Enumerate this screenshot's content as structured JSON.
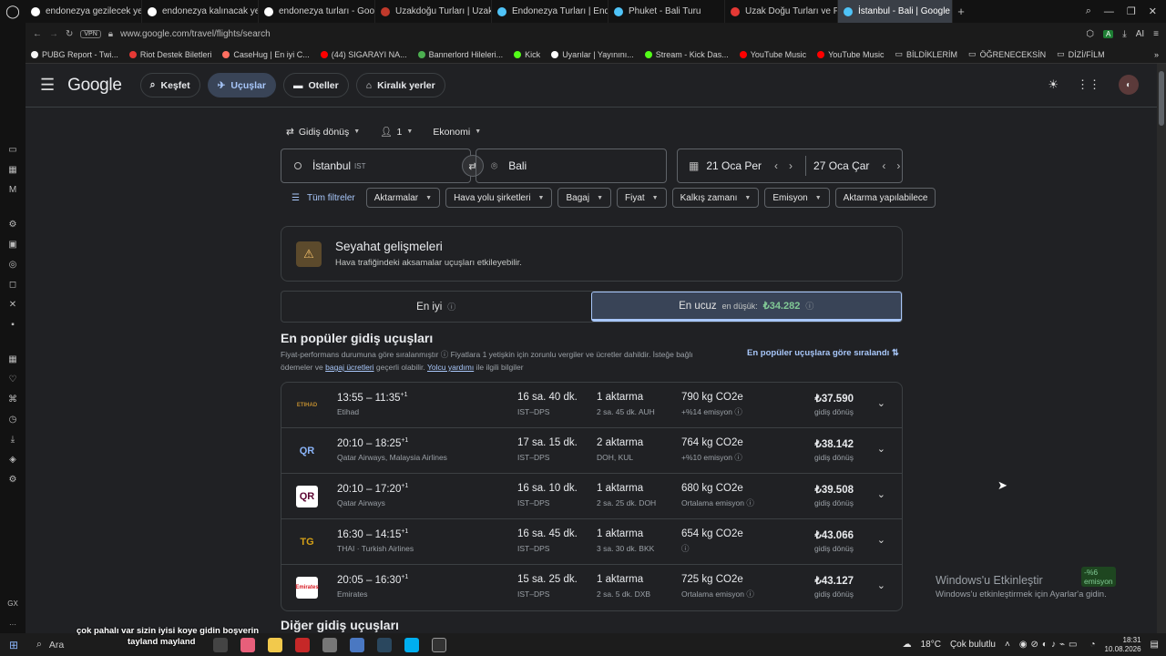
{
  "tabs": [
    {
      "title": "endonezya gezilecek yerle",
      "color": "#ffffff"
    },
    {
      "title": "endonezya kalınacak yerle",
      "color": "#ffffff"
    },
    {
      "title": "endonezya turları - Googl",
      "color": "#ffffff"
    },
    {
      "title": "Uzakdoğu Turları | Uzakdo",
      "color": "#c0392b"
    },
    {
      "title": "Endonezya Turları | Endon",
      "color": "#4fc3f7"
    },
    {
      "title": "Phuket - Bali Turu",
      "color": "#4fc3f7"
    },
    {
      "title": "Uzak Doğu Turları ve Fiyat",
      "color": "#e53935"
    },
    {
      "title": "İstanbul - Bali | Google Uçu",
      "color": "#4fc3f7"
    }
  ],
  "address": {
    "vpn": "VPN",
    "url": "www.google.com/travel/flights/search",
    "ai": "AI"
  },
  "bookmarks": [
    {
      "label": "PUBG Report - Twi...",
      "color": "#f5f5f5"
    },
    {
      "label": "Riot Destek Biletleri",
      "color": "#e53935"
    },
    {
      "label": "CaseHug | En iyi C...",
      "color": "#ff6f61"
    },
    {
      "label": "(44) SIGARAYI NA...",
      "color": "#ff0000"
    },
    {
      "label": "Bannerlord Hileleri...",
      "color": "#4caf50"
    },
    {
      "label": "Kick",
      "color": "#53fc18"
    },
    {
      "label": "Uyarılar | Yayınını...",
      "color": "#ffffff"
    },
    {
      "label": "Stream - Kick Das...",
      "color": "#53fc18"
    },
    {
      "label": "YouTube Music",
      "color": "#ff0000"
    },
    {
      "label": "YouTube Music",
      "color": "#ff0000"
    },
    {
      "label": "BİLDİKLERİM",
      "color": "#cccccc"
    },
    {
      "label": "ÖĞRENECEKSİN",
      "color": "#cccccc"
    },
    {
      "label": "DİZİ/FİLM",
      "color": "#cccccc"
    }
  ],
  "header": {
    "logo": "Google",
    "nav": [
      "Keşfet",
      "Uçuşlar",
      "Oteller",
      "Kiralık yerler"
    ]
  },
  "search": {
    "trip_type": "Gidiş dönüş",
    "passengers": "1",
    "cabin": "Ekonomi",
    "origin": "İstanbul",
    "origin_code": "IST",
    "destination": "Bali",
    "depart": "21 Oca Per",
    "return": "27 Oca Çar"
  },
  "filters": [
    "Tüm filtreler",
    "Aktarmalar",
    "Hava yolu şirketleri",
    "Bagaj",
    "Fiyat",
    "Kalkış zamanı",
    "Emisyon",
    "Aktarma yapılabilece"
  ],
  "notice": {
    "title": "Seyahat gelişmeleri",
    "text": "Hava trafiğindeki aksamalar uçuşları etkileyebilir."
  },
  "sort_tabs": {
    "best": "En iyi",
    "cheapest": "En ucuz",
    "lowest_label": "en düşük:",
    "lowest_price": "₺34.282"
  },
  "section": {
    "title": "En popüler gidiş uçuşları",
    "sub1": "Fiyat-performans durumuna göre sıralanmıştır",
    "sub2": "Fiyatlara 1 yetişkin için zorunlu vergiler ve ücretler dahildir. İsteğe bağlı ödemeler ve",
    "sub_link1": "bagaj ücretleri",
    "sub3": "geçerli olabilir.",
    "sub_link2": "Yolcu yardımı",
    "sub4": "ile ilgili bilgiler",
    "sort_link": "En popüler uçuşlara göre sıralandı"
  },
  "flights": [
    {
      "logo": "ETIHAD",
      "logo_color": "#bd8b2f",
      "logo_bg": "#202124",
      "time": "13:55 – 11:35",
      "plus": "+1",
      "airline": "Etihad",
      "duration": "16 sa. 40 dk.",
      "route": "IST–DPS",
      "stops": "1 aktarma",
      "stop_detail": "2 sa. 45 dk. AUH",
      "co2": "790 kg CO2e",
      "emission": "+%14 emisyon",
      "green": false,
      "price": "₺37.590",
      "price_type": "gidiş dönüş"
    },
    {
      "logo": "QR",
      "logo_color": "#8ab4f8",
      "logo_bg": "#202124",
      "time": "20:10 – 18:25",
      "plus": "+1",
      "airline": "Qatar Airways, Malaysia Airlines",
      "duration": "17 sa. 15 dk.",
      "route": "IST–DPS",
      "stops": "2 aktarma",
      "stop_detail": "DOH, KUL",
      "co2": "764 kg CO2e",
      "emission": "+%10 emisyon",
      "green": false,
      "price": "₺38.142",
      "price_type": "gidiş dönüş"
    },
    {
      "logo": "QR",
      "logo_color": "#5c0632",
      "logo_bg": "#ffffff",
      "time": "20:10 – 17:20",
      "plus": "+1",
      "airline": "Qatar Airways",
      "duration": "16 sa. 10 dk.",
      "route": "IST–DPS",
      "stops": "1 aktarma",
      "stop_detail": "2 sa. 25 dk. DOH",
      "co2": "680 kg CO2e",
      "emission": "Ortalama emisyon",
      "green": false,
      "price": "₺39.508",
      "price_type": "gidiş dönüş"
    },
    {
      "logo": "TG",
      "logo_color": "#d4a017",
      "logo_bg": "#202124",
      "time": "16:30 – 14:15",
      "plus": "+1",
      "airline": "THAI · Turkish Airlines",
      "duration": "16 sa. 45 dk.",
      "route": "IST–DPS",
      "stops": "1 aktarma",
      "stop_detail": "3 sa. 30 dk. BKK",
      "co2": "654 kg CO2e",
      "emission": "-%6 emisyon",
      "green": true,
      "price": "₺43.066",
      "price_type": "gidiş dönüş"
    },
    {
      "logo": "Emirates",
      "logo_color": "#d71921",
      "logo_bg": "#ffffff",
      "time": "20:05 – 16:30",
      "plus": "+1",
      "airline": "Emirates",
      "duration": "15 sa. 25 dk.",
      "route": "IST–DPS",
      "stops": "1 aktarma",
      "stop_detail": "2 sa. 5 dk. DXB",
      "co2": "725 kg CO2e",
      "emission": "Ortalama emisyon",
      "green": false,
      "price": "₺43.127",
      "price_type": "gidiş dönüş"
    }
  ],
  "other_title": "Diğer gidiş uçuşları",
  "windows_activation": {
    "title": "Windows'u Etkinleştir",
    "text": "Windows'u etkinleştirmek için Ayarlar'a gidin."
  },
  "overlay": {
    "line1": "çok pahalı var sizin iyisi koye gidin boşverin",
    "line2": "tayland mayland"
  },
  "taskbar": {
    "search": "Ara",
    "weather": "18°C",
    "weather_text": "Çok bulutlu",
    "time": "18:31",
    "date": "10.08.2026"
  }
}
